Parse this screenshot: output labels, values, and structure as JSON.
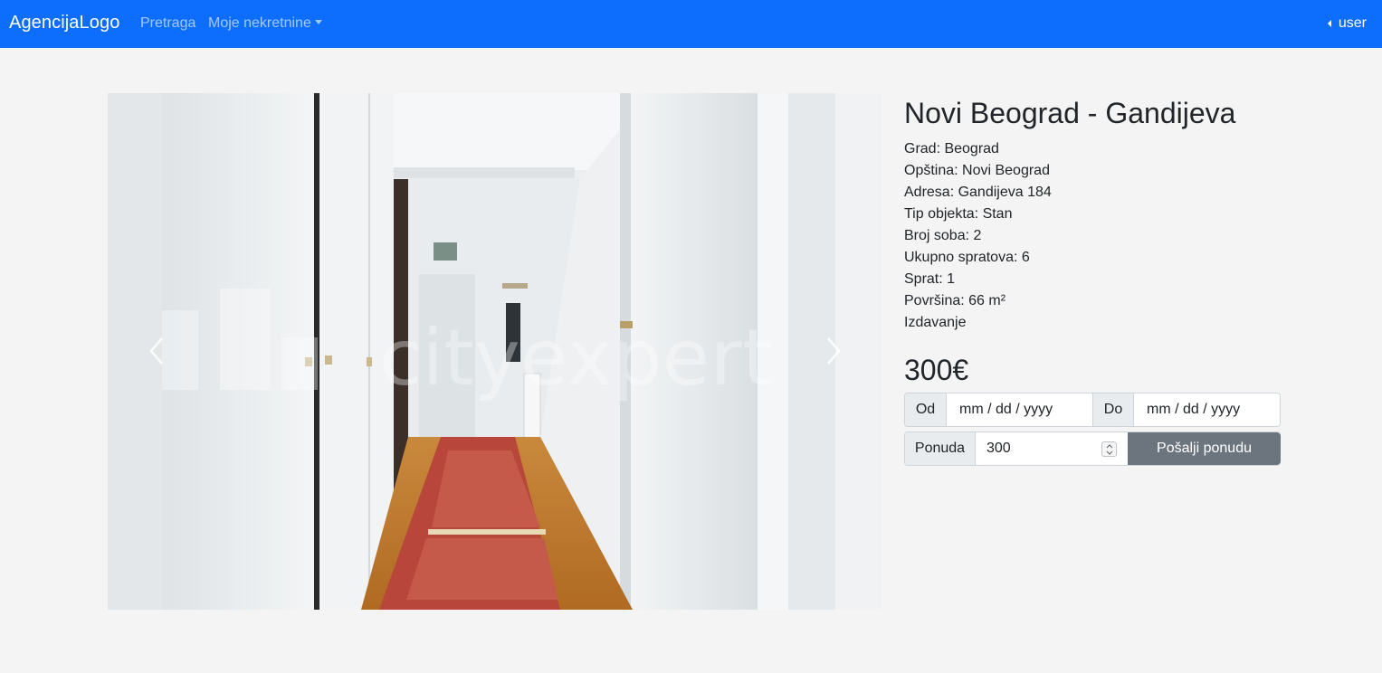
{
  "navbar": {
    "brand": "AgencijaLogo",
    "links": [
      {
        "label": "Pretraga"
      },
      {
        "label": "Moje nekretnine"
      }
    ],
    "user_label": "user",
    "bg_color": "#0d6efd"
  },
  "listing": {
    "title": "Novi Beograd - Gandijeva",
    "info": [
      "Grad: Beograd",
      "Opština: Novi Beograd",
      "Adresa: Gandijeva 184",
      "Tip objekta: Stan",
      "Broj soba: 2",
      "Ukupno spratova: 6",
      "Sprat: 1",
      "Površina: 66 m²",
      "Izdavanje"
    ],
    "price": "300€",
    "photo_watermark": "cityexpert"
  },
  "booking": {
    "from_label": "Od",
    "from_placeholder": "mm / dd / yyyy",
    "to_label": "Do",
    "to_placeholder": "mm / dd / yyyy",
    "offer_label": "Ponuda",
    "offer_value": "300",
    "send_label": "Pošalji ponudu",
    "send_color": "#6c757d"
  }
}
